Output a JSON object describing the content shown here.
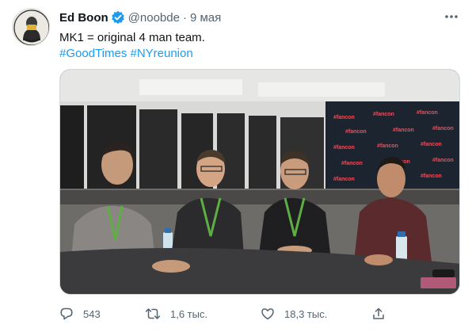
{
  "tweet": {
    "author": {
      "display_name": "Ed Boon",
      "handle": "@noobde",
      "verified": true,
      "avatar_icon": "avatar-masked-man"
    },
    "time_separator": "·",
    "time": "9 мая",
    "text_line1": "MK1 = original 4 man team.",
    "hashtags": [
      "#GoodTimes",
      "#NYreunion"
    ],
    "media": {
      "backdrop_brand": "#fancon"
    },
    "actions": {
      "replies": "543",
      "retweets": "1,6 тыс.",
      "likes": "18,3 тыс.",
      "share_icon": "share-icon"
    }
  },
  "colors": {
    "accent": "#1d9bf0",
    "text": "#0f1419",
    "secondary": "#536471"
  }
}
